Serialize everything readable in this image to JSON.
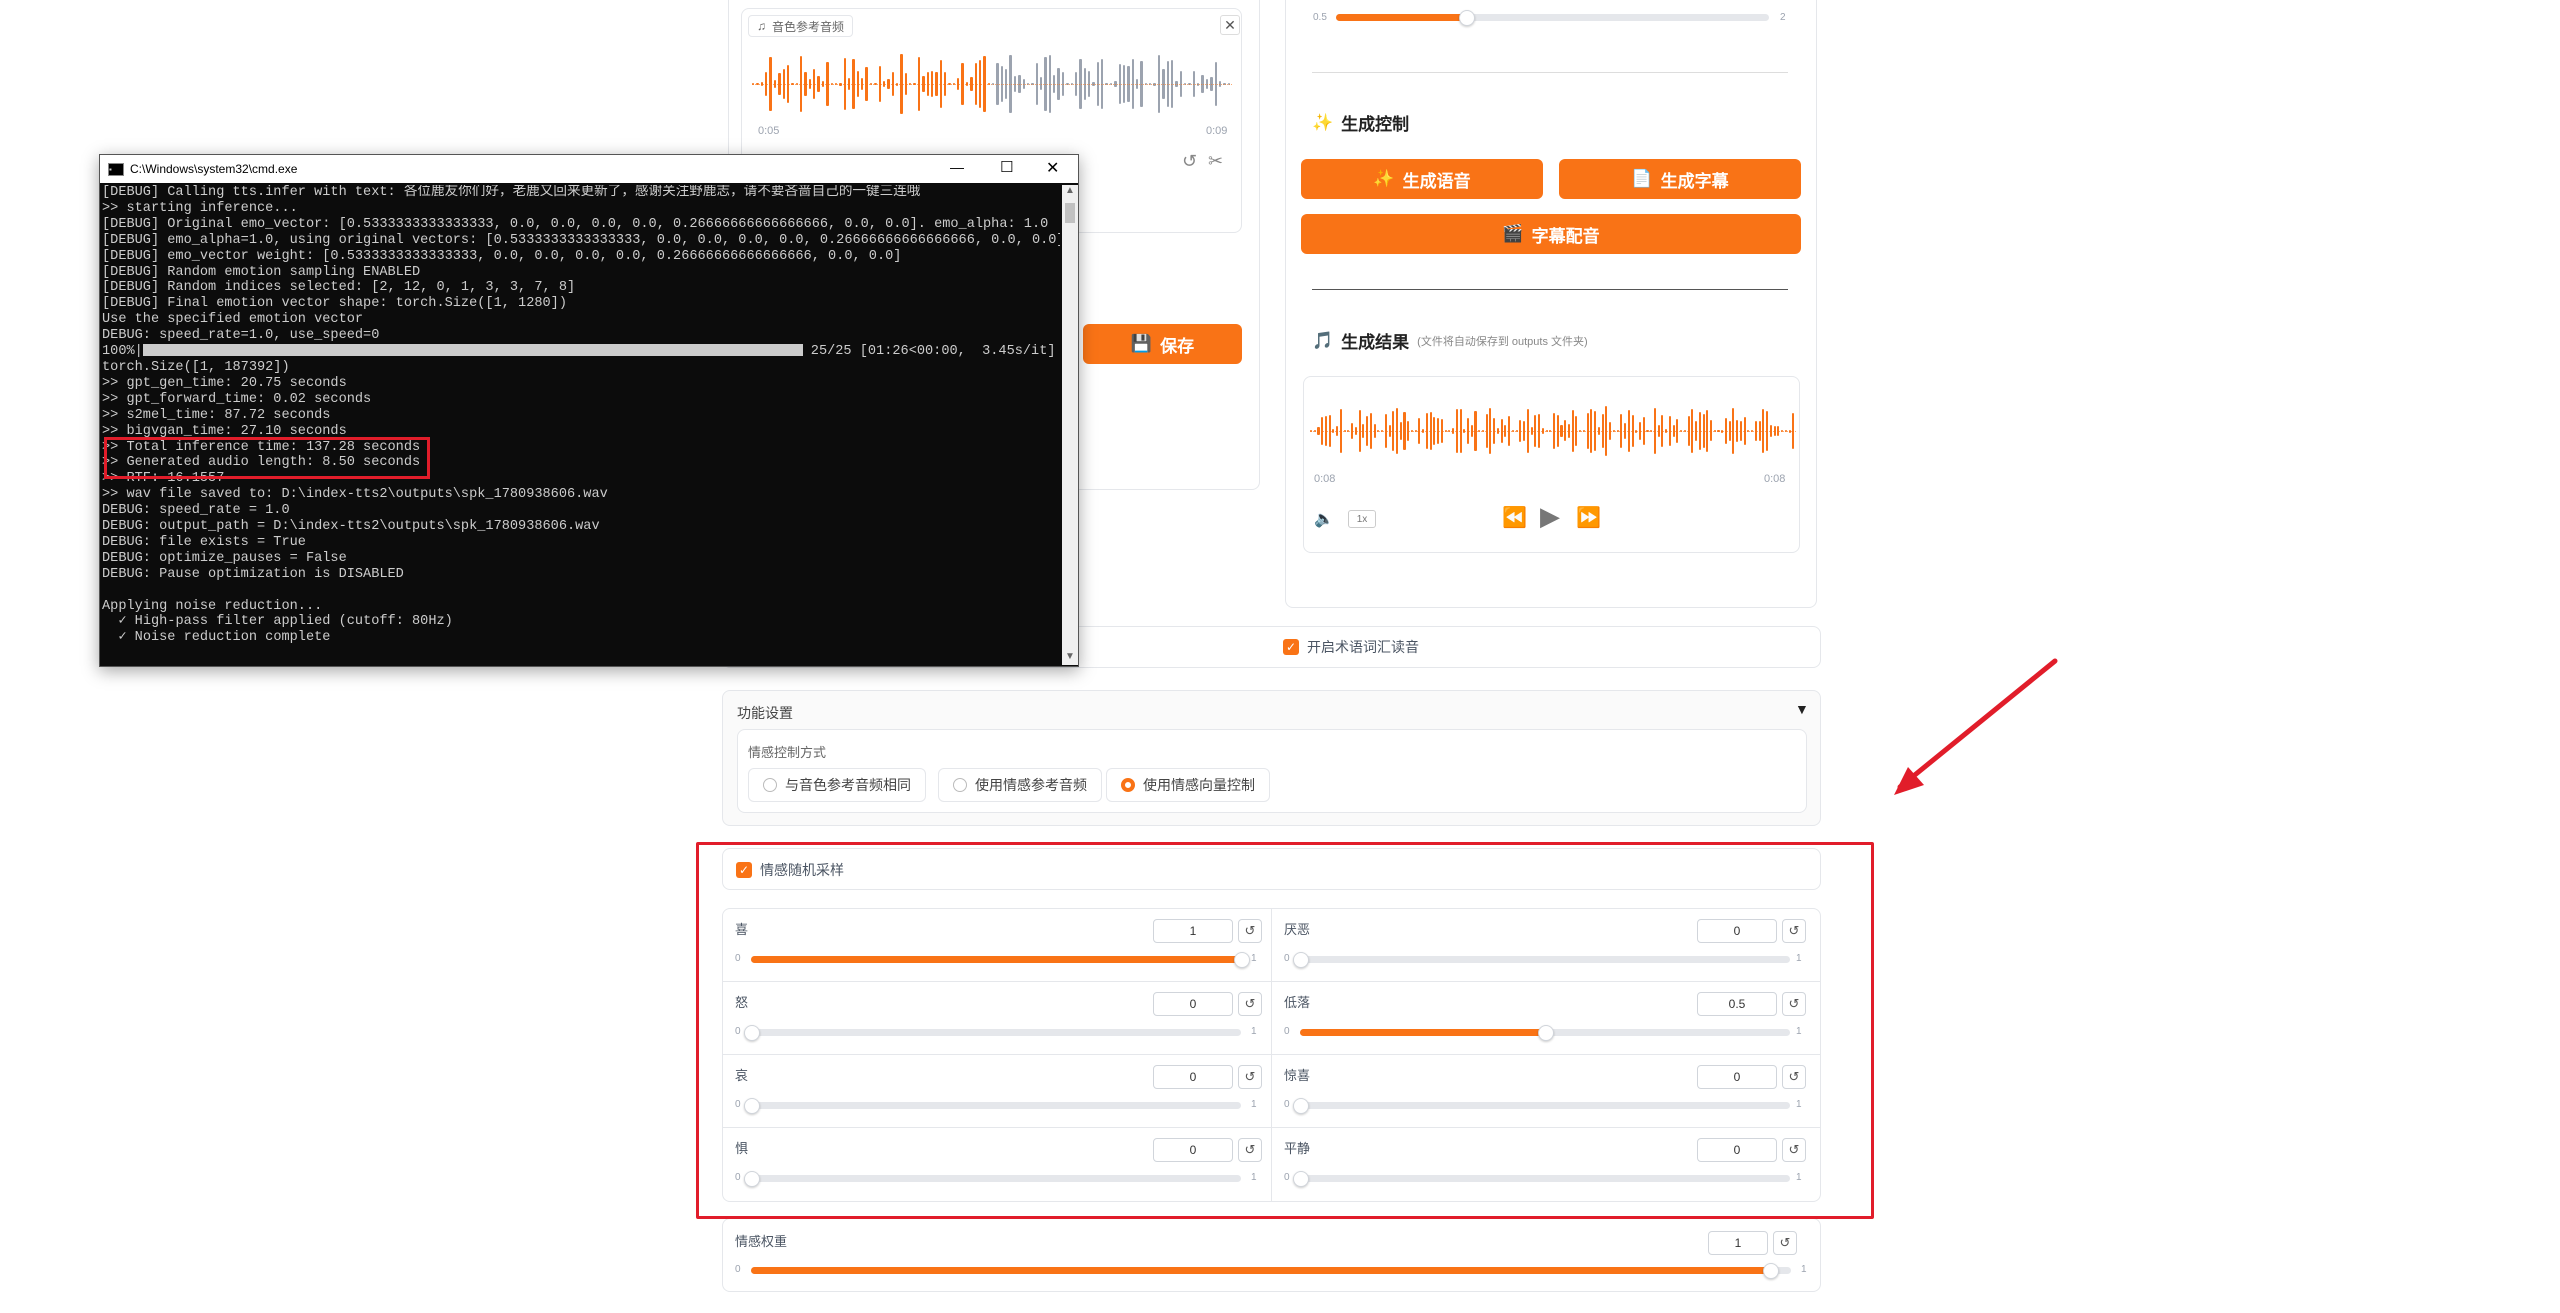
{
  "ref_audio": {
    "label": "音色参考音频",
    "time_start": "0:05",
    "time_end": "0:09"
  },
  "top_slider": {
    "min": "0.5",
    "max": "2",
    "fraction": 0.3
  },
  "save_button": {
    "label": "保存"
  },
  "gen_control": {
    "title": "生成控制",
    "btn_speech": "生成语音",
    "btn_subtitle": "生成字幕",
    "btn_dub": "字幕配音"
  },
  "gen_result": {
    "title": "生成结果",
    "hint": "(文件将自动保存到 outputs 文件夹)",
    "time_start": "0:08",
    "time_end": "0:08",
    "speed": "1x"
  },
  "term_checkbox": {
    "label": "开启术语词汇读音"
  },
  "func_settings": {
    "title": "功能设置",
    "emotion_mode_label": "情感控制方式",
    "options": [
      "与音色参考音频相同",
      "使用情感参考音频",
      "使用情感向量控制"
    ],
    "selected": 2
  },
  "emotion_random": {
    "label": "情感随机采样"
  },
  "emotions": [
    {
      "name": "喜",
      "value": "1",
      "fraction": 1.0,
      "min": "0",
      "max": "1"
    },
    {
      "name": "厌恶",
      "value": "0",
      "fraction": 0.0,
      "min": "0",
      "max": "1"
    },
    {
      "name": "怒",
      "value": "0",
      "fraction": 0.0,
      "min": "0",
      "max": "1"
    },
    {
      "name": "低落",
      "value": "0.5",
      "fraction": 0.5,
      "min": "0",
      "max": "1"
    },
    {
      "name": "哀",
      "value": "0",
      "fraction": 0.0,
      "min": "0",
      "max": "1"
    },
    {
      "name": "惊喜",
      "value": "0",
      "fraction": 0.0,
      "min": "0",
      "max": "1"
    },
    {
      "name": "惧",
      "value": "0",
      "fraction": 0.0,
      "min": "0",
      "max": "1"
    },
    {
      "name": "平静",
      "value": "0",
      "fraction": 0.0,
      "min": "0",
      "max": "1"
    }
  ],
  "emotion_weight": {
    "label": "情感权重",
    "value": "1",
    "min": "0",
    "max": "1",
    "fraction": 0.98
  },
  "cmd_window": {
    "title": "C:\\Windows\\system32\\cmd.exe",
    "lines": [
      "[DEBUG] Calling tts.infer with text: 各位鹿友你们好，老鹿又回来更新了，感谢关注野鹿志，请不要吝啬自己的一键三连哦",
      ">> starting inference...",
      "[DEBUG] Original emo_vector: [0.5333333333333333, 0.0, 0.0, 0.0, 0.0, 0.26666666666666666, 0.0, 0.0]. emo_alpha: 1.0",
      "[DEBUG] emo_alpha=1.0, using original vectors: [0.5333333333333333, 0.0, 0.0, 0.0, 0.0, 0.26666666666666666, 0.0, 0.0]",
      "[DEBUG] emo_vector weight: [0.5333333333333333, 0.0, 0.0, 0.0, 0.0, 0.26666666666666666, 0.0, 0.0]",
      "[DEBUG] Random emotion sampling ENABLED",
      "[DEBUG] Random indices selected: [2, 12, 0, 1, 3, 3, 7, 8]",
      "[DEBUG] Final emotion vector shape: torch.Size([1, 1280])",
      "Use the specified emotion vector",
      "DEBUG: speed_rate=1.0, use_speed=0",
      "100%|",
      "torch.Size([1, 187392])",
      ">> gpt_gen_time: 20.75 seconds",
      ">> gpt_forward_time: 0.02 seconds",
      ">> s2mel_time: 87.72 seconds",
      ">> bigvgan_time: 27.10 seconds",
      ">> Total inference time: 137.28 seconds",
      ">> Generated audio length: 8.50 seconds",
      ">> RTF: 16.1557",
      ">> wav file saved to: D:\\index-tts2\\outputs\\spk_1780938606.wav",
      "DEBUG: speed_rate = 1.0",
      "DEBUG: output_path = D:\\index-tts2\\outputs\\spk_1780938606.wav",
      "DEBUG: file exists = True",
      "DEBUG: optimize_pauses = False",
      "DEBUG: Pause optimization is DISABLED",
      "",
      "Applying noise reduction...",
      "  ✓ High-pass filter applied (cutoff: 80Hz)",
      "  ✓ Noise reduction complete"
    ],
    "progress_text": "25/25 [01:26<00:00,  3.45s/it]",
    "progress_fraction": 1.0
  },
  "colors": {
    "accent": "#f97316",
    "highlight": "#e11d2a"
  }
}
